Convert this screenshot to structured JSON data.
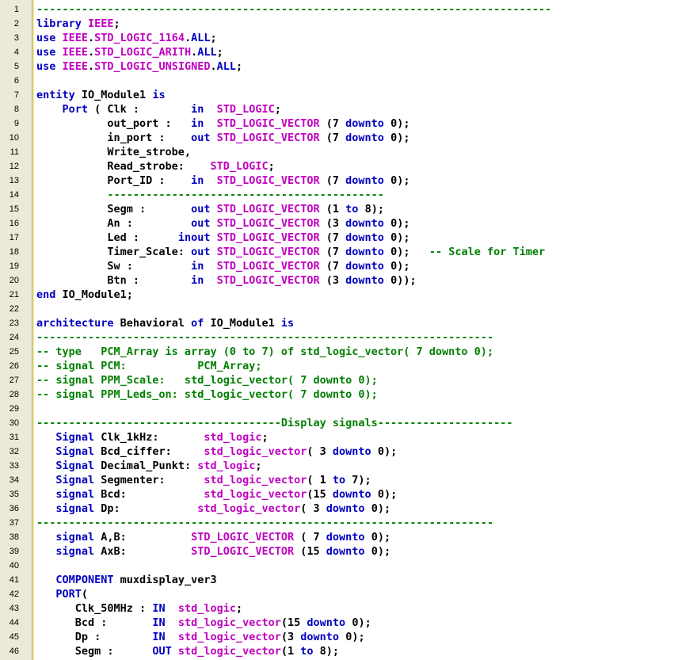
{
  "editor": {
    "lines": [
      {
        "n": "1",
        "tokens": [
          {
            "c": "c",
            "t": "--------------------------------------------------------------------------------"
          }
        ]
      },
      {
        "n": "2",
        "tokens": [
          {
            "c": "k",
            "t": "library "
          },
          {
            "c": "t",
            "t": "IEEE"
          },
          {
            "c": "x",
            "t": ";"
          }
        ]
      },
      {
        "n": "3",
        "tokens": [
          {
            "c": "k",
            "t": "use "
          },
          {
            "c": "t",
            "t": "IEEE"
          },
          {
            "c": "x",
            "t": "."
          },
          {
            "c": "t",
            "t": "STD_LOGIC_1164"
          },
          {
            "c": "x",
            "t": "."
          },
          {
            "c": "k",
            "t": "ALL"
          },
          {
            "c": "x",
            "t": ";"
          }
        ]
      },
      {
        "n": "4",
        "tokens": [
          {
            "c": "k",
            "t": "use "
          },
          {
            "c": "t",
            "t": "IEEE"
          },
          {
            "c": "x",
            "t": "."
          },
          {
            "c": "t",
            "t": "STD_LOGIC_ARITH"
          },
          {
            "c": "x",
            "t": "."
          },
          {
            "c": "k",
            "t": "ALL"
          },
          {
            "c": "x",
            "t": ";"
          }
        ]
      },
      {
        "n": "5",
        "tokens": [
          {
            "c": "k",
            "t": "use "
          },
          {
            "c": "t",
            "t": "IEEE"
          },
          {
            "c": "x",
            "t": "."
          },
          {
            "c": "t",
            "t": "STD_LOGIC_UNSIGNED"
          },
          {
            "c": "x",
            "t": "."
          },
          {
            "c": "k",
            "t": "ALL"
          },
          {
            "c": "x",
            "t": ";"
          }
        ]
      },
      {
        "n": "6",
        "tokens": []
      },
      {
        "n": "7",
        "tokens": [
          {
            "c": "k",
            "t": "entity "
          },
          {
            "c": "x",
            "t": "IO_Module1 "
          },
          {
            "c": "k",
            "t": "is"
          }
        ]
      },
      {
        "n": "8",
        "tokens": [
          {
            "c": "x",
            "t": "    "
          },
          {
            "c": "k",
            "t": "Port"
          },
          {
            "c": "x",
            "t": " ( Clk :        "
          },
          {
            "c": "k",
            "t": "in"
          },
          {
            "c": "x",
            "t": "  "
          },
          {
            "c": "t",
            "t": "STD_LOGIC"
          },
          {
            "c": "x",
            "t": ";"
          }
        ]
      },
      {
        "n": "9",
        "tokens": [
          {
            "c": "x",
            "t": "           out_port :   "
          },
          {
            "c": "k",
            "t": "in"
          },
          {
            "c": "x",
            "t": "  "
          },
          {
            "c": "t",
            "t": "STD_LOGIC_VECTOR"
          },
          {
            "c": "x",
            "t": " (7 "
          },
          {
            "c": "k",
            "t": "downto"
          },
          {
            "c": "x",
            "t": " 0);"
          }
        ]
      },
      {
        "n": "10",
        "tokens": [
          {
            "c": "x",
            "t": "           in_port :    "
          },
          {
            "c": "k",
            "t": "out"
          },
          {
            "c": "x",
            "t": " "
          },
          {
            "c": "t",
            "t": "STD_LOGIC_VECTOR"
          },
          {
            "c": "x",
            "t": " (7 "
          },
          {
            "c": "k",
            "t": "downto"
          },
          {
            "c": "x",
            "t": " 0);"
          }
        ]
      },
      {
        "n": "11",
        "tokens": [
          {
            "c": "x",
            "t": "           Write_strobe,"
          }
        ]
      },
      {
        "n": "12",
        "tokens": [
          {
            "c": "x",
            "t": "           Read_strobe:    "
          },
          {
            "c": "t",
            "t": "STD_LOGIC"
          },
          {
            "c": "x",
            "t": ";"
          }
        ]
      },
      {
        "n": "13",
        "tokens": [
          {
            "c": "x",
            "t": "           Port_ID :    "
          },
          {
            "c": "k",
            "t": "in"
          },
          {
            "c": "x",
            "t": "  "
          },
          {
            "c": "t",
            "t": "STD_LOGIC_VECTOR"
          },
          {
            "c": "x",
            "t": " (7 "
          },
          {
            "c": "k",
            "t": "downto"
          },
          {
            "c": "x",
            "t": " 0);"
          }
        ]
      },
      {
        "n": "14",
        "tokens": [
          {
            "c": "x",
            "t": "           "
          },
          {
            "c": "c",
            "t": "-------------------------------------------"
          }
        ]
      },
      {
        "n": "15",
        "tokens": [
          {
            "c": "x",
            "t": "           Segm :       "
          },
          {
            "c": "k",
            "t": "out"
          },
          {
            "c": "x",
            "t": " "
          },
          {
            "c": "t",
            "t": "STD_LOGIC_VECTOR"
          },
          {
            "c": "x",
            "t": " (1 "
          },
          {
            "c": "k",
            "t": "to"
          },
          {
            "c": "x",
            "t": " 8);"
          }
        ]
      },
      {
        "n": "16",
        "tokens": [
          {
            "c": "x",
            "t": "           An :         "
          },
          {
            "c": "k",
            "t": "out"
          },
          {
            "c": "x",
            "t": " "
          },
          {
            "c": "t",
            "t": "STD_LOGIC_VECTOR"
          },
          {
            "c": "x",
            "t": " (3 "
          },
          {
            "c": "k",
            "t": "downto"
          },
          {
            "c": "x",
            "t": " 0);"
          }
        ]
      },
      {
        "n": "17",
        "tokens": [
          {
            "c": "x",
            "t": "           Led :      "
          },
          {
            "c": "k",
            "t": "inout"
          },
          {
            "c": "x",
            "t": " "
          },
          {
            "c": "t",
            "t": "STD_LOGIC_VECTOR"
          },
          {
            "c": "x",
            "t": " (7 "
          },
          {
            "c": "k",
            "t": "downto"
          },
          {
            "c": "x",
            "t": " 0);"
          }
        ]
      },
      {
        "n": "18",
        "tokens": [
          {
            "c": "x",
            "t": "           Timer_Scale: "
          },
          {
            "c": "k",
            "t": "out"
          },
          {
            "c": "x",
            "t": " "
          },
          {
            "c": "t",
            "t": "STD_LOGIC_VECTOR"
          },
          {
            "c": "x",
            "t": " (7 "
          },
          {
            "c": "k",
            "t": "downto"
          },
          {
            "c": "x",
            "t": " 0);   "
          },
          {
            "c": "c",
            "t": "-- Scale for Timer"
          }
        ]
      },
      {
        "n": "19",
        "tokens": [
          {
            "c": "x",
            "t": "           Sw :         "
          },
          {
            "c": "k",
            "t": "in"
          },
          {
            "c": "x",
            "t": "  "
          },
          {
            "c": "t",
            "t": "STD_LOGIC_VECTOR"
          },
          {
            "c": "x",
            "t": " (7 "
          },
          {
            "c": "k",
            "t": "downto"
          },
          {
            "c": "x",
            "t": " 0);"
          }
        ]
      },
      {
        "n": "20",
        "tokens": [
          {
            "c": "x",
            "t": "           Btn :        "
          },
          {
            "c": "k",
            "t": "in"
          },
          {
            "c": "x",
            "t": "  "
          },
          {
            "c": "t",
            "t": "STD_LOGIC_VECTOR"
          },
          {
            "c": "x",
            "t": " (3 "
          },
          {
            "c": "k",
            "t": "downto"
          },
          {
            "c": "x",
            "t": " 0));"
          }
        ]
      },
      {
        "n": "21",
        "tokens": [
          {
            "c": "k",
            "t": "end"
          },
          {
            "c": "x",
            "t": " IO_Module1;"
          }
        ]
      },
      {
        "n": "22",
        "tokens": []
      },
      {
        "n": "23",
        "tokens": [
          {
            "c": "k",
            "t": "architecture"
          },
          {
            "c": "x",
            "t": " Behavioral "
          },
          {
            "c": "k",
            "t": "of"
          },
          {
            "c": "x",
            "t": " IO_Module1 "
          },
          {
            "c": "k",
            "t": "is"
          }
        ]
      },
      {
        "n": "24",
        "tokens": [
          {
            "c": "c",
            "t": "-----------------------------------------------------------------------"
          }
        ]
      },
      {
        "n": "25",
        "tokens": [
          {
            "c": "c",
            "t": "-- type   PCM_Array is array (0 to 7) of std_logic_vector( 7 downto 0);"
          }
        ]
      },
      {
        "n": "26",
        "tokens": [
          {
            "c": "c",
            "t": "-- signal PCM:           PCM_Array;"
          }
        ]
      },
      {
        "n": "27",
        "tokens": [
          {
            "c": "c",
            "t": "-- signal PPM_Scale:   std_logic_vector( 7 downto 0);"
          }
        ]
      },
      {
        "n": "28",
        "tokens": [
          {
            "c": "c",
            "t": "-- signal PPM_Leds_on: std_logic_vector( 7 downto 0);"
          }
        ]
      },
      {
        "n": "29",
        "tokens": []
      },
      {
        "n": "30",
        "tokens": [
          {
            "c": "c",
            "t": "--------------------------------------Display signals---------------------"
          }
        ]
      },
      {
        "n": "31",
        "tokens": [
          {
            "c": "x",
            "t": "   "
          },
          {
            "c": "k",
            "t": "Signal"
          },
          {
            "c": "x",
            "t": " Clk_1kHz:       "
          },
          {
            "c": "t",
            "t": "std_logic"
          },
          {
            "c": "x",
            "t": ";"
          }
        ]
      },
      {
        "n": "32",
        "tokens": [
          {
            "c": "x",
            "t": "   "
          },
          {
            "c": "k",
            "t": "Signal"
          },
          {
            "c": "x",
            "t": " Bcd_ciffer:     "
          },
          {
            "c": "t",
            "t": "std_logic_vector"
          },
          {
            "c": "x",
            "t": "( 3 "
          },
          {
            "c": "k",
            "t": "downto"
          },
          {
            "c": "x",
            "t": " 0);"
          }
        ]
      },
      {
        "n": "33",
        "tokens": [
          {
            "c": "x",
            "t": "   "
          },
          {
            "c": "k",
            "t": "Signal"
          },
          {
            "c": "x",
            "t": " Decimal_Punkt: "
          },
          {
            "c": "t",
            "t": "std_logic"
          },
          {
            "c": "x",
            "t": ";"
          }
        ]
      },
      {
        "n": "34",
        "tokens": [
          {
            "c": "x",
            "t": "   "
          },
          {
            "c": "k",
            "t": "Signal"
          },
          {
            "c": "x",
            "t": " Segmenter:      "
          },
          {
            "c": "t",
            "t": "std_logic_vector"
          },
          {
            "c": "x",
            "t": "( 1 "
          },
          {
            "c": "k",
            "t": "to"
          },
          {
            "c": "x",
            "t": " 7);"
          }
        ]
      },
      {
        "n": "35",
        "tokens": [
          {
            "c": "x",
            "t": "   "
          },
          {
            "c": "k",
            "t": "signal"
          },
          {
            "c": "x",
            "t": " Bcd:            "
          },
          {
            "c": "t",
            "t": "std_logic_vector"
          },
          {
            "c": "x",
            "t": "(15 "
          },
          {
            "c": "k",
            "t": "downto"
          },
          {
            "c": "x",
            "t": " 0);"
          }
        ]
      },
      {
        "n": "36",
        "tokens": [
          {
            "c": "x",
            "t": "   "
          },
          {
            "c": "k",
            "t": "signal"
          },
          {
            "c": "x",
            "t": " Dp:            "
          },
          {
            "c": "t",
            "t": "std_logic_vector"
          },
          {
            "c": "x",
            "t": "( 3 "
          },
          {
            "c": "k",
            "t": "downto"
          },
          {
            "c": "x",
            "t": " 0);"
          }
        ]
      },
      {
        "n": "37",
        "tokens": [
          {
            "c": "c",
            "t": "-----------------------------------------------------------------------"
          }
        ]
      },
      {
        "n": "38",
        "tokens": [
          {
            "c": "x",
            "t": "   "
          },
          {
            "c": "k",
            "t": "signal"
          },
          {
            "c": "x",
            "t": " A,B:          "
          },
          {
            "c": "t",
            "t": "STD_LOGIC_VECTOR"
          },
          {
            "c": "x",
            "t": " ( 7 "
          },
          {
            "c": "k",
            "t": "downto"
          },
          {
            "c": "x",
            "t": " 0);"
          }
        ]
      },
      {
        "n": "39",
        "tokens": [
          {
            "c": "x",
            "t": "   "
          },
          {
            "c": "k",
            "t": "signal"
          },
          {
            "c": "x",
            "t": " AxB:          "
          },
          {
            "c": "t",
            "t": "STD_LOGIC_VECTOR"
          },
          {
            "c": "x",
            "t": " (15 "
          },
          {
            "c": "k",
            "t": "downto"
          },
          {
            "c": "x",
            "t": " 0);"
          }
        ]
      },
      {
        "n": "40",
        "tokens": []
      },
      {
        "n": "41",
        "tokens": [
          {
            "c": "x",
            "t": "   "
          },
          {
            "c": "k",
            "t": "COMPONENT"
          },
          {
            "c": "x",
            "t": " muxdisplay_ver3"
          }
        ]
      },
      {
        "n": "42",
        "tokens": [
          {
            "c": "x",
            "t": "   "
          },
          {
            "c": "k",
            "t": "PORT"
          },
          {
            "c": "x",
            "t": "("
          }
        ]
      },
      {
        "n": "43",
        "tokens": [
          {
            "c": "x",
            "t": "      Clk_50MHz : "
          },
          {
            "c": "k",
            "t": "IN"
          },
          {
            "c": "x",
            "t": "  "
          },
          {
            "c": "t",
            "t": "std_logic"
          },
          {
            "c": "x",
            "t": ";"
          }
        ]
      },
      {
        "n": "44",
        "tokens": [
          {
            "c": "x",
            "t": "      Bcd :       "
          },
          {
            "c": "k",
            "t": "IN"
          },
          {
            "c": "x",
            "t": "  "
          },
          {
            "c": "t",
            "t": "std_logic_vector"
          },
          {
            "c": "x",
            "t": "(15 "
          },
          {
            "c": "k",
            "t": "downto"
          },
          {
            "c": "x",
            "t": " 0);"
          }
        ]
      },
      {
        "n": "45",
        "tokens": [
          {
            "c": "x",
            "t": "      Dp :        "
          },
          {
            "c": "k",
            "t": "IN"
          },
          {
            "c": "x",
            "t": "  "
          },
          {
            "c": "t",
            "t": "std_logic_vector"
          },
          {
            "c": "x",
            "t": "(3 "
          },
          {
            "c": "k",
            "t": "downto"
          },
          {
            "c": "x",
            "t": " 0);"
          }
        ]
      },
      {
        "n": "46",
        "tokens": [
          {
            "c": "x",
            "t": "      Segm :      "
          },
          {
            "c": "k",
            "t": "OUT"
          },
          {
            "c": "x",
            "t": " "
          },
          {
            "c": "t",
            "t": "std_logic_vector"
          },
          {
            "c": "x",
            "t": "(1 "
          },
          {
            "c": "k",
            "t": "to"
          },
          {
            "c": "x",
            "t": " 8);"
          }
        ]
      }
    ]
  },
  "colors": {
    "keyword": "#0000c0",
    "type": "#c000c0",
    "comment": "#008000",
    "text": "#000000",
    "gutter": "#ece9d8"
  }
}
